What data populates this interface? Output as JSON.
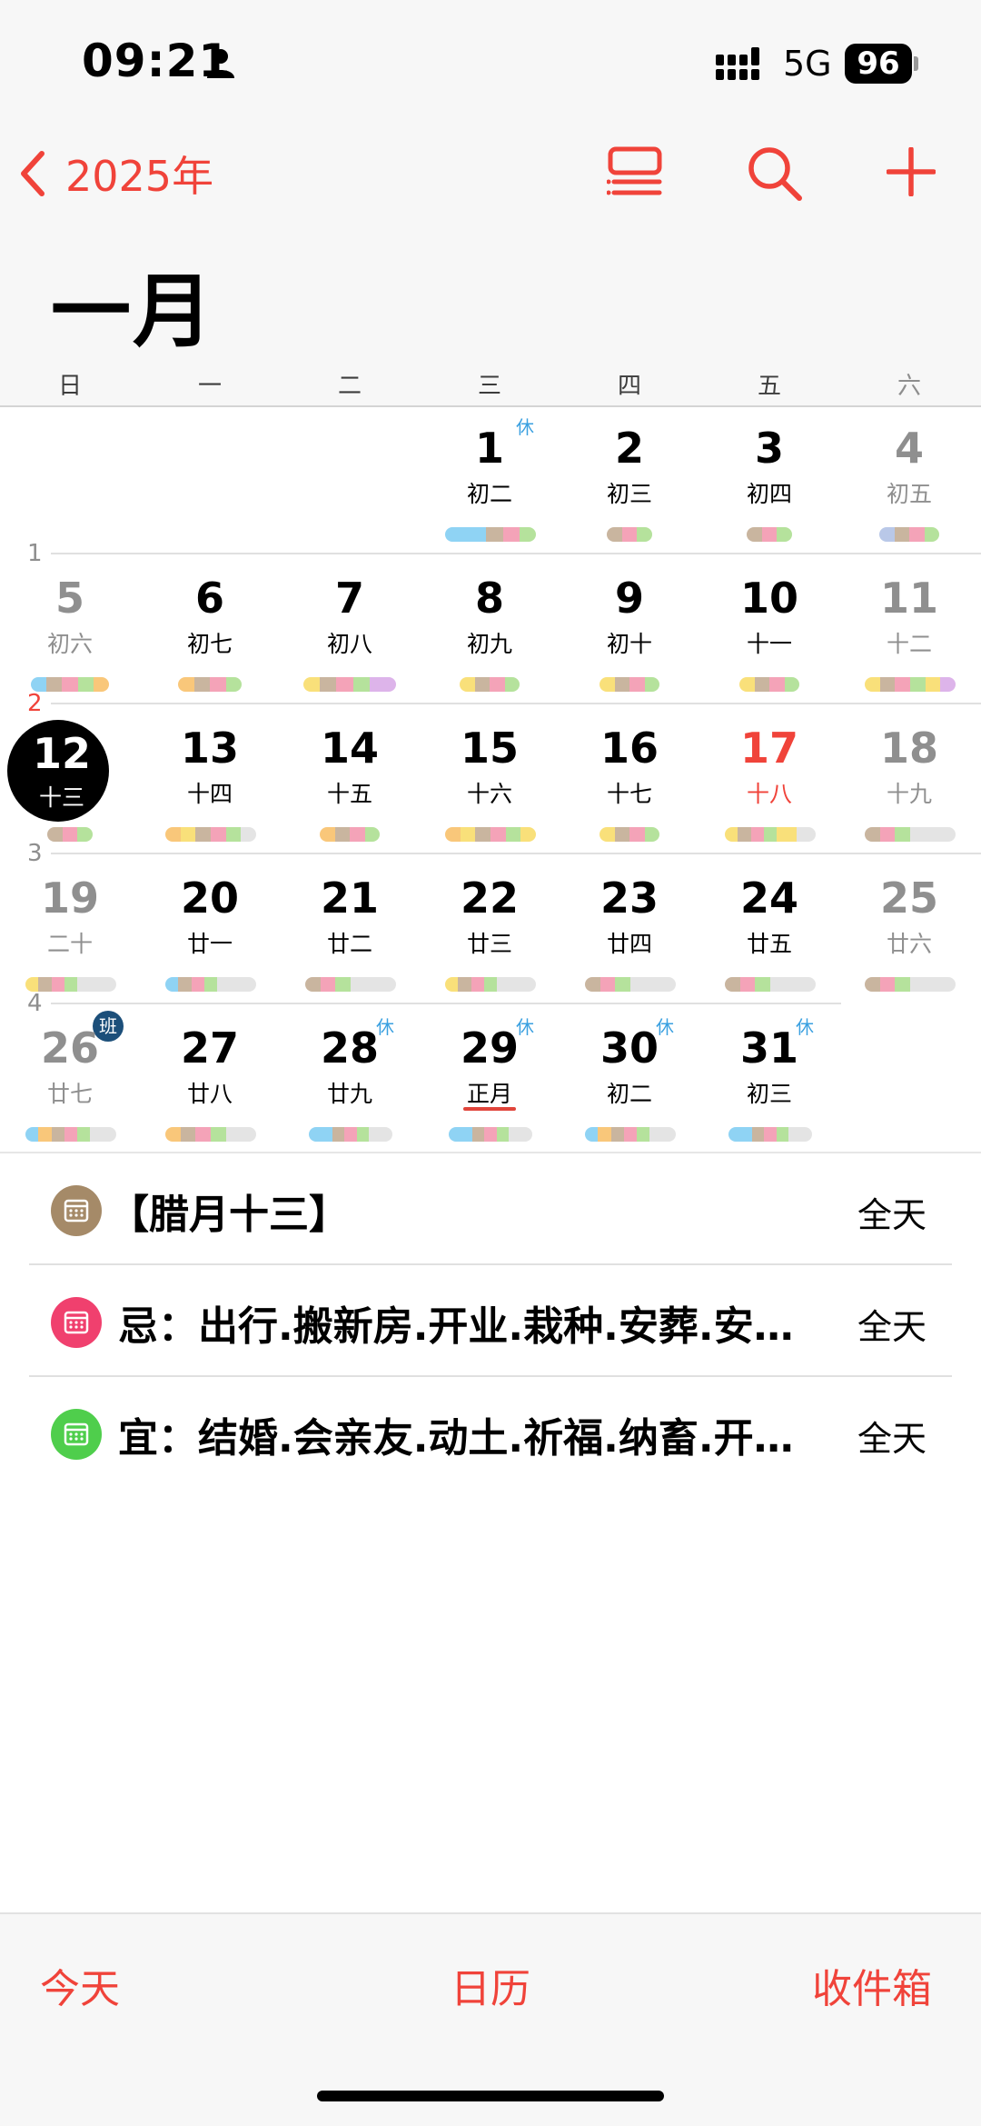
{
  "status_bar": {
    "time": "09:21",
    "network": "5G",
    "battery": "96"
  },
  "nav": {
    "back_label": "2025年"
  },
  "month_title": "一月",
  "weekdays": [
    "日",
    "一",
    "二",
    "三",
    "四",
    "五",
    "六"
  ],
  "week_numbers": [
    "1",
    "2",
    "3",
    "4"
  ],
  "colors": {
    "accent": "#f0433a",
    "holiday_badge": "#3aa0e0",
    "work_badge": "#1c4f7a"
  },
  "days": {
    "d1": {
      "num": "1",
      "lunar": "初二",
      "badge": "休"
    },
    "d2": {
      "num": "2",
      "lunar": "初三"
    },
    "d3": {
      "num": "3",
      "lunar": "初四"
    },
    "d4": {
      "num": "4",
      "lunar": "初五"
    },
    "d5": {
      "num": "5",
      "lunar": "初六"
    },
    "d6": {
      "num": "6",
      "lunar": "初七"
    },
    "d7": {
      "num": "7",
      "lunar": "初八"
    },
    "d8": {
      "num": "8",
      "lunar": "初九"
    },
    "d9": {
      "num": "9",
      "lunar": "初十"
    },
    "d10": {
      "num": "10",
      "lunar": "十一"
    },
    "d11": {
      "num": "11",
      "lunar": "十二"
    },
    "d12": {
      "num": "12",
      "lunar": "十三"
    },
    "d13": {
      "num": "13",
      "lunar": "十四"
    },
    "d14": {
      "num": "14",
      "lunar": "十五"
    },
    "d15": {
      "num": "15",
      "lunar": "十六"
    },
    "d16": {
      "num": "16",
      "lunar": "十七"
    },
    "d17": {
      "num": "17",
      "lunar": "十八"
    },
    "d18": {
      "num": "18",
      "lunar": "十九"
    },
    "d19": {
      "num": "19",
      "lunar": "二十"
    },
    "d20": {
      "num": "20",
      "lunar": "廿一"
    },
    "d21": {
      "num": "21",
      "lunar": "廿二"
    },
    "d22": {
      "num": "22",
      "lunar": "廿三"
    },
    "d23": {
      "num": "23",
      "lunar": "廿四"
    },
    "d24": {
      "num": "24",
      "lunar": "廿五"
    },
    "d25": {
      "num": "25",
      "lunar": "廿六"
    },
    "d26": {
      "num": "26",
      "lunar": "廿七",
      "badge": "班"
    },
    "d27": {
      "num": "27",
      "lunar": "廿八"
    },
    "d28": {
      "num": "28",
      "lunar": "廿九",
      "badge": "休"
    },
    "d29": {
      "num": "29",
      "lunar": "正月",
      "badge": "休"
    },
    "d30": {
      "num": "30",
      "lunar": "初二",
      "badge": "休"
    },
    "d31": {
      "num": "31",
      "lunar": "初三",
      "badge": "休"
    }
  },
  "events": [
    {
      "title": "【腊月十三】",
      "time": "全天",
      "icon": "calendar-icon",
      "color": "#a58a68"
    },
    {
      "title": "忌：出行.搬新房.开业.栽种.安葬.安…",
      "time": "全天",
      "icon": "calendar-icon",
      "color": "#f0406e"
    },
    {
      "title": "宜：结婚.会亲友.动土.祈福.纳畜.开…",
      "time": "全天",
      "icon": "calendar-icon",
      "color": "#4fce4c"
    }
  ],
  "tabbar": {
    "today": "今天",
    "calendars": "日历",
    "inbox": "收件箱"
  }
}
